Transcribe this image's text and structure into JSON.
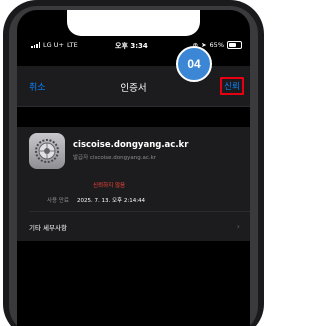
{
  "status_bar": {
    "carrier": "LG U+",
    "network": "LTE",
    "time": "오후 3:34",
    "battery_percent": "65%"
  },
  "nav": {
    "cancel_label": "취소",
    "title": "인증서",
    "trust_label": "신뢰"
  },
  "step_badge": "04",
  "certificate": {
    "name": "ciscoise.dongyang.ac.kr",
    "issuer": "발급자 ciscoise.dongyang.ac.kr",
    "status": "신뢰하지 않음",
    "expiry_label": "사용 만료",
    "expiry_value": "2025. 7. 13. 오후 2:14:44",
    "more_details_label": "기타 세부사항"
  },
  "colors": {
    "accent": "#0a84ff",
    "highlight_box": "#e60012",
    "badge": "#3b87d6",
    "warning": "#ff453a"
  }
}
